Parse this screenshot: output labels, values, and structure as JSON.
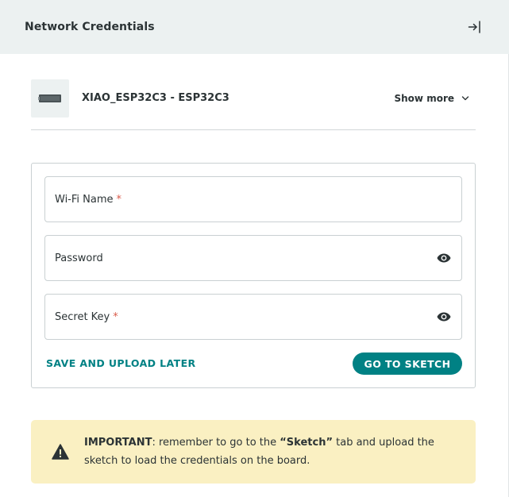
{
  "header": {
    "title": "Network Credentials",
    "close_icon": "exit-panel-icon"
  },
  "device": {
    "name": "XIAO_ESP32C3 - ESP32C3",
    "thumbnail_icon": "board-icon",
    "show_more_label": "Show more"
  },
  "form": {
    "wifi_name_label": "Wi-Fi Name",
    "wifi_name_required": "*",
    "password_label": "Password",
    "secret_key_label": "Secret Key",
    "secret_key_required": "*",
    "save_later_label": "SAVE AND UPLOAD LATER",
    "go_to_sketch_label": "GO TO SKETCH"
  },
  "notice": {
    "icon": "warning-icon",
    "strong_prefix": "IMPORTANT",
    "text_part1": ": remember to go to the ",
    "quoted_tab": "“Sketch”",
    "text_part2": " tab and upload the sketch to load the credentials on the board."
  },
  "colors": {
    "accent": "#008184",
    "header_bg": "#ecf1f1",
    "notice_bg": "#faf0c2",
    "required": "#da5b4a"
  }
}
